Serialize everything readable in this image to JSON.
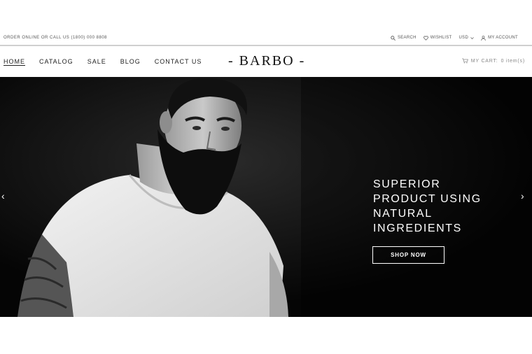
{
  "topbar": {
    "order_text": "ORDER ONLINE OR CALL US (1800) 000 8808",
    "search_label": "SEARCH",
    "wishlist_label": "WISHLIST",
    "currency_label": "USD",
    "account_label": "MY ACCOUNT"
  },
  "nav": {
    "items": [
      "HOME",
      "CATALOG",
      "SALE",
      "BLOG",
      "CONTACT US"
    ],
    "active": "HOME"
  },
  "logo": {
    "text": "- BARBO -"
  },
  "cart": {
    "label": "MY CART:",
    "count": "0 item(s)"
  },
  "hero": {
    "headline_lines": [
      "SUPERIOR",
      "PRODUCT USING",
      "NATURAL",
      "INGREDIENTS"
    ],
    "button_label": "SHOP NOW",
    "prev_arrow": "‹",
    "next_arrow": "›"
  },
  "icons": {
    "search": "search-icon",
    "wishlist": "heart-icon",
    "currency": "chevron-down-icon",
    "account": "user-icon",
    "cart": "cart-icon"
  },
  "colors": {
    "hero_background": "#050505",
    "text": "#222222",
    "muted": "#888888",
    "button_border": "#ffffff"
  }
}
